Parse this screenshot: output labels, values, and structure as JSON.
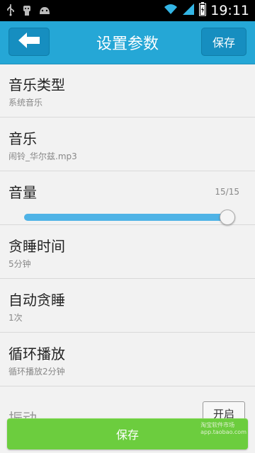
{
  "status_bar": {
    "time": "19:11"
  },
  "header": {
    "title": "设置参数",
    "save_label": "保存"
  },
  "settings": [
    {
      "label": "音乐类型",
      "value": "系统音乐"
    },
    {
      "label": "音乐",
      "value": "闹铃_华尔兹.mp3"
    },
    {
      "label": "音量",
      "value": "15/15"
    },
    {
      "label": "贪睡时间",
      "value": "5分钟"
    },
    {
      "label": "自动贪睡",
      "value": "1次"
    },
    {
      "label": "循环播放",
      "value": "循环播放2分钟"
    }
  ],
  "volume": {
    "current": 15,
    "max": 15
  },
  "partial_item": {
    "label": "振动",
    "toggle_label": "开启"
  },
  "bottom_save_label": "保存",
  "watermark": {
    "line1": "淘宝软件市场",
    "line2": "app.taobao.com"
  },
  "colors": {
    "header": "#25a7d6",
    "save_bottom": "#6ccd3e",
    "slider": "#4fb3e6"
  }
}
